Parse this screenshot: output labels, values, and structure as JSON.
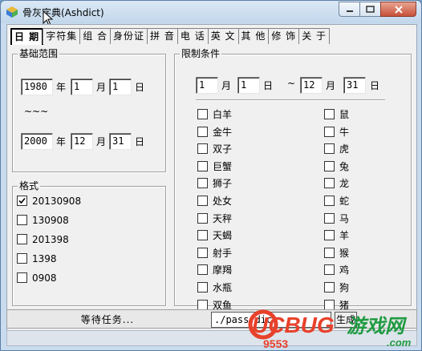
{
  "window": {
    "title": "骨灰字典(Ashdict)"
  },
  "tabs": [
    {
      "label": "日 期",
      "active": true
    },
    {
      "label": "字符集",
      "active": false
    },
    {
      "label": "组 合",
      "active": false
    },
    {
      "label": "身份证",
      "active": false
    },
    {
      "label": "拼 音",
      "active": false
    },
    {
      "label": "电 话",
      "active": false
    },
    {
      "label": "英 文",
      "active": false
    },
    {
      "label": "其 他",
      "active": false
    },
    {
      "label": "修 饰",
      "active": false
    },
    {
      "label": "关 于",
      "active": false
    }
  ],
  "range": {
    "legend": "基础范围",
    "start": {
      "year": "1980",
      "month": "1",
      "day": "1"
    },
    "separator": "~~~",
    "end": {
      "year": "2000",
      "month": "12",
      "day": "31"
    },
    "unit_year": "年",
    "unit_month": "月",
    "unit_day": "日"
  },
  "format": {
    "legend": "格式",
    "options": [
      {
        "label": "20130908",
        "checked": true
      },
      {
        "label": "130908",
        "checked": false
      },
      {
        "label": "201398",
        "checked": false
      },
      {
        "label": "1398",
        "checked": false
      },
      {
        "label": "0908",
        "checked": false
      }
    ]
  },
  "limits": {
    "legend": "限制条件",
    "from": {
      "month": "1",
      "day": "1"
    },
    "tilde": "~",
    "to": {
      "month": "12",
      "day": "31"
    },
    "unit_month": "月",
    "unit_day": "日",
    "zodiac_signs": [
      "白羊",
      "金牛",
      "双子",
      "巨蟹",
      "狮子",
      "处女",
      "天秤",
      "天蝎",
      "射手",
      "摩羯",
      "水瓶",
      "双鱼"
    ],
    "chinese_zodiac": [
      "鼠",
      "牛",
      "虎",
      "兔",
      "龙",
      "蛇",
      "马",
      "羊",
      "猴",
      "鸡",
      "狗",
      "猪"
    ]
  },
  "status": {
    "text": "等待任务...",
    "path": "./pass.dic",
    "generate_label": "生成"
  },
  "watermark": {
    "brand": "UCBUG",
    "suffix": "游戏网",
    "site": ".com",
    "sub": "9553"
  }
}
